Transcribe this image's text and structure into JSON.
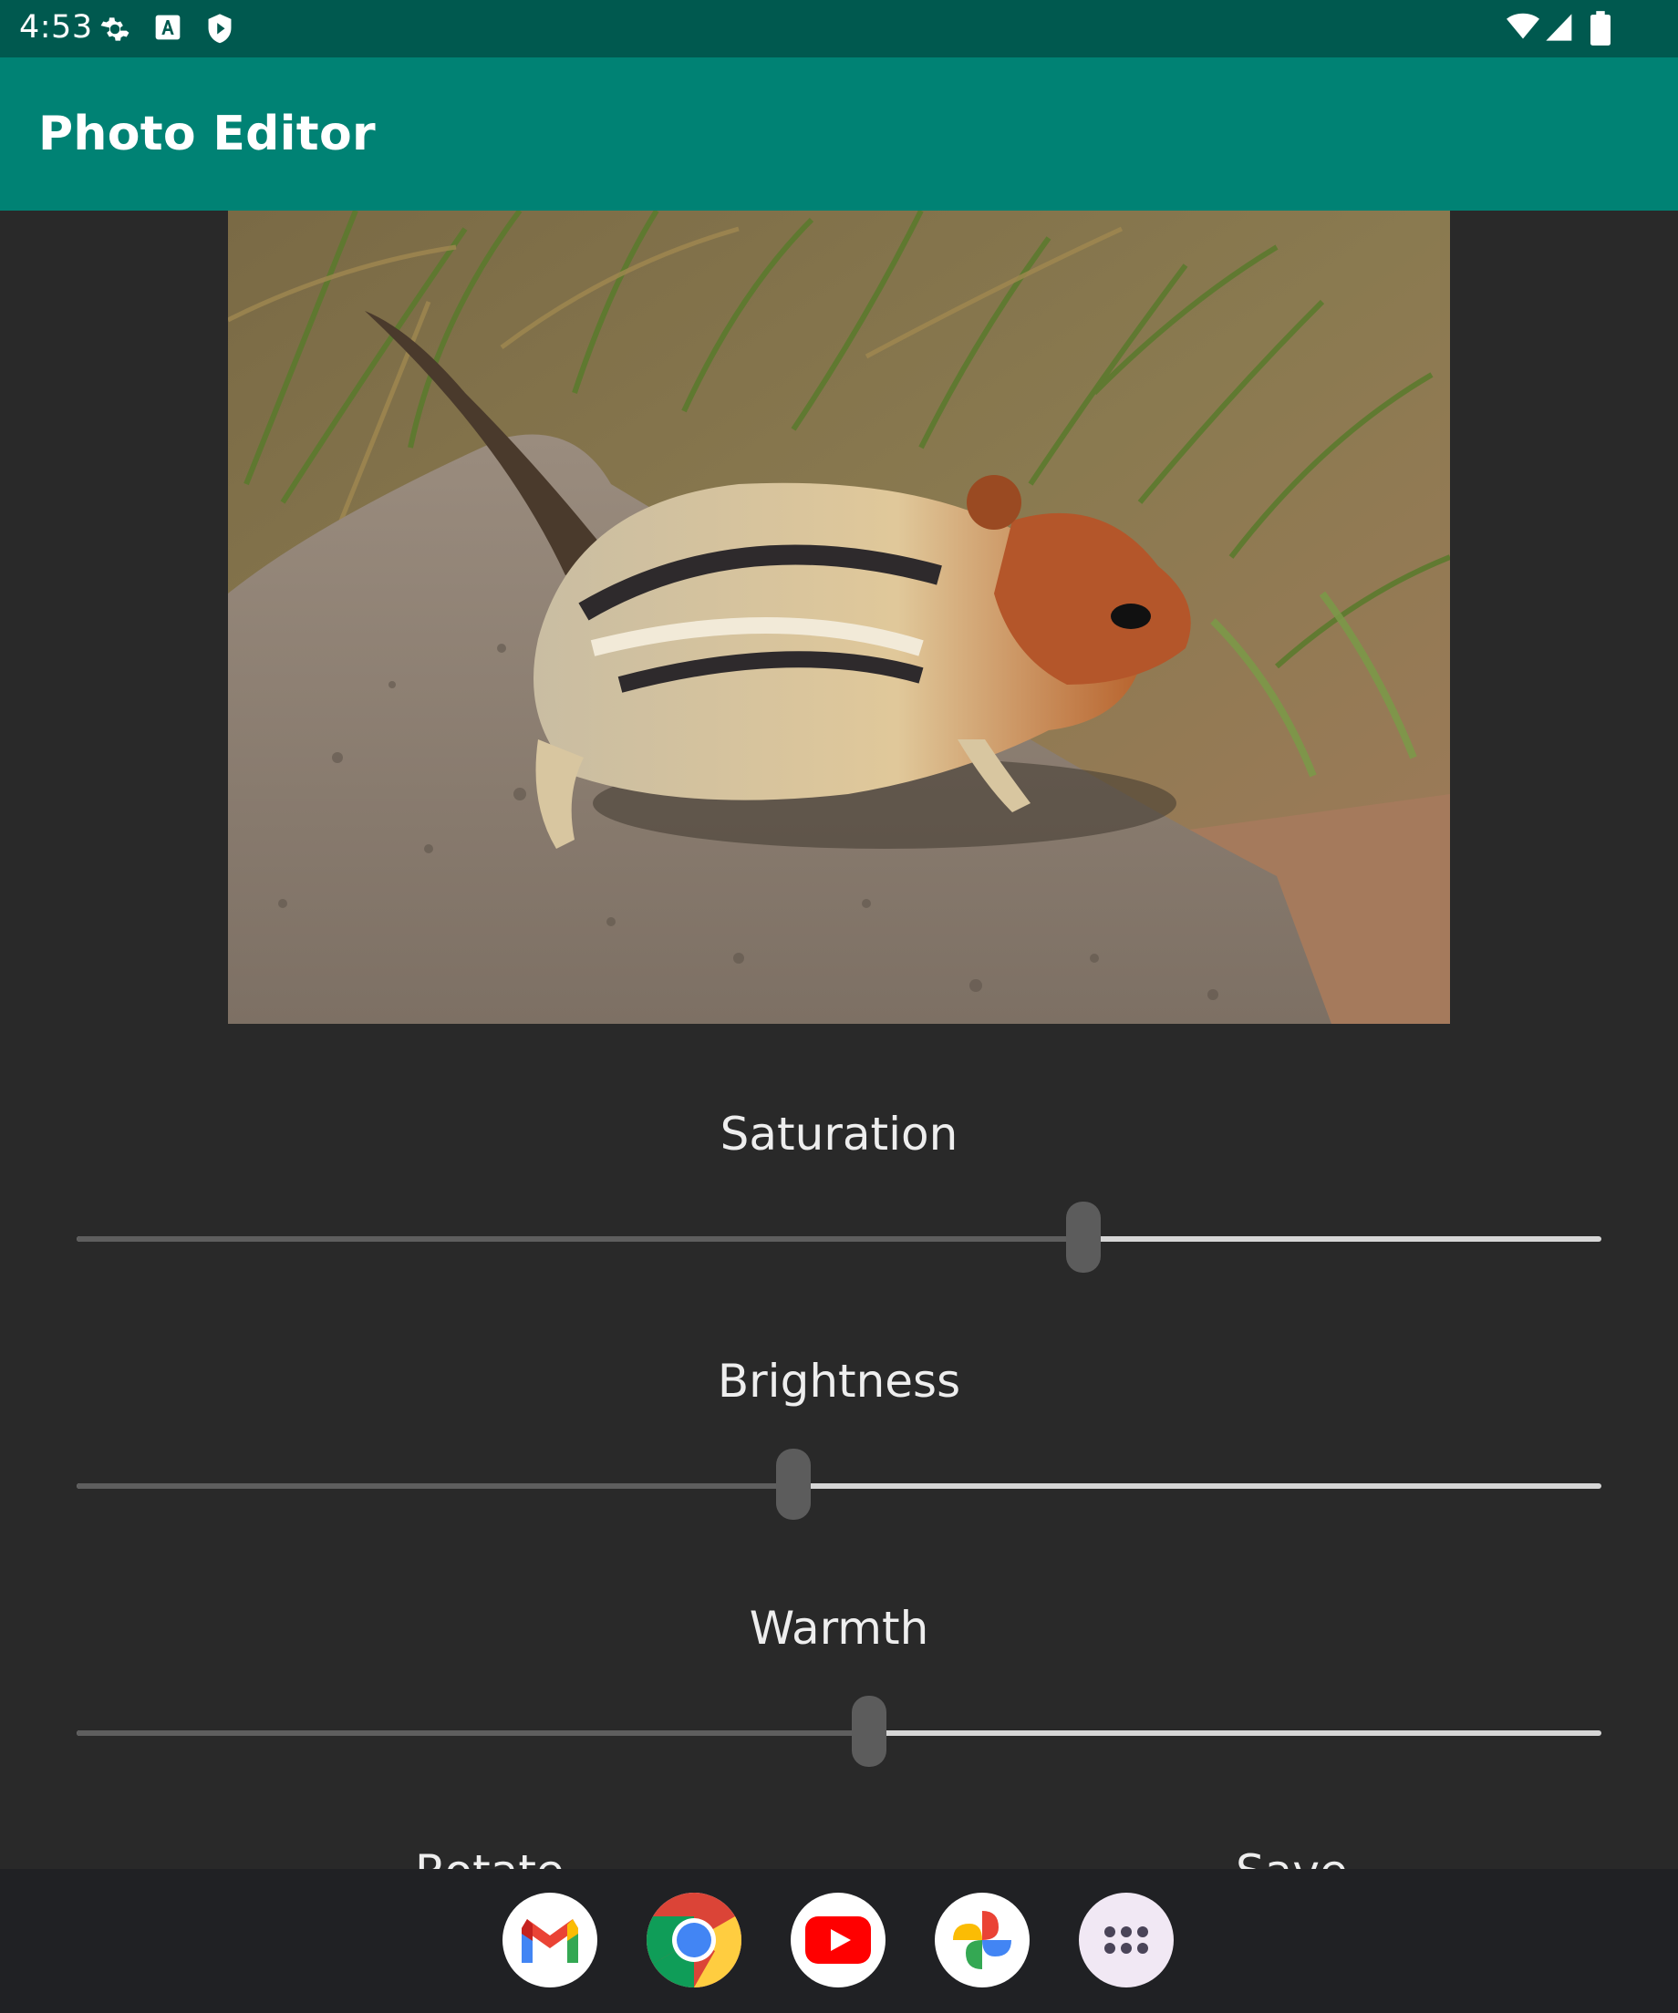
{
  "status_bar": {
    "time": "4:53",
    "left_icons": [
      "gear-icon",
      "font-a-icon",
      "shield-icon"
    ],
    "right_icons": [
      "wifi-icon",
      "cell-signal-icon",
      "battery-icon"
    ],
    "background": "#00594f"
  },
  "app_bar": {
    "title": "Photo Editor",
    "background": "#008274"
  },
  "photo": {
    "subject": "chipmunk-on-rock"
  },
  "sliders": [
    {
      "label": "Saturation",
      "value_percent": 66
    },
    {
      "label": "Brightness",
      "value_percent": 47
    },
    {
      "label": "Warmth",
      "value_percent": 52
    }
  ],
  "buttons": {
    "left_label": "Rotate",
    "right_label": "Save"
  },
  "dock": {
    "apps": [
      "gmail-icon",
      "chrome-icon",
      "youtube-icon",
      "photos-icon",
      "app-drawer-icon"
    ]
  }
}
